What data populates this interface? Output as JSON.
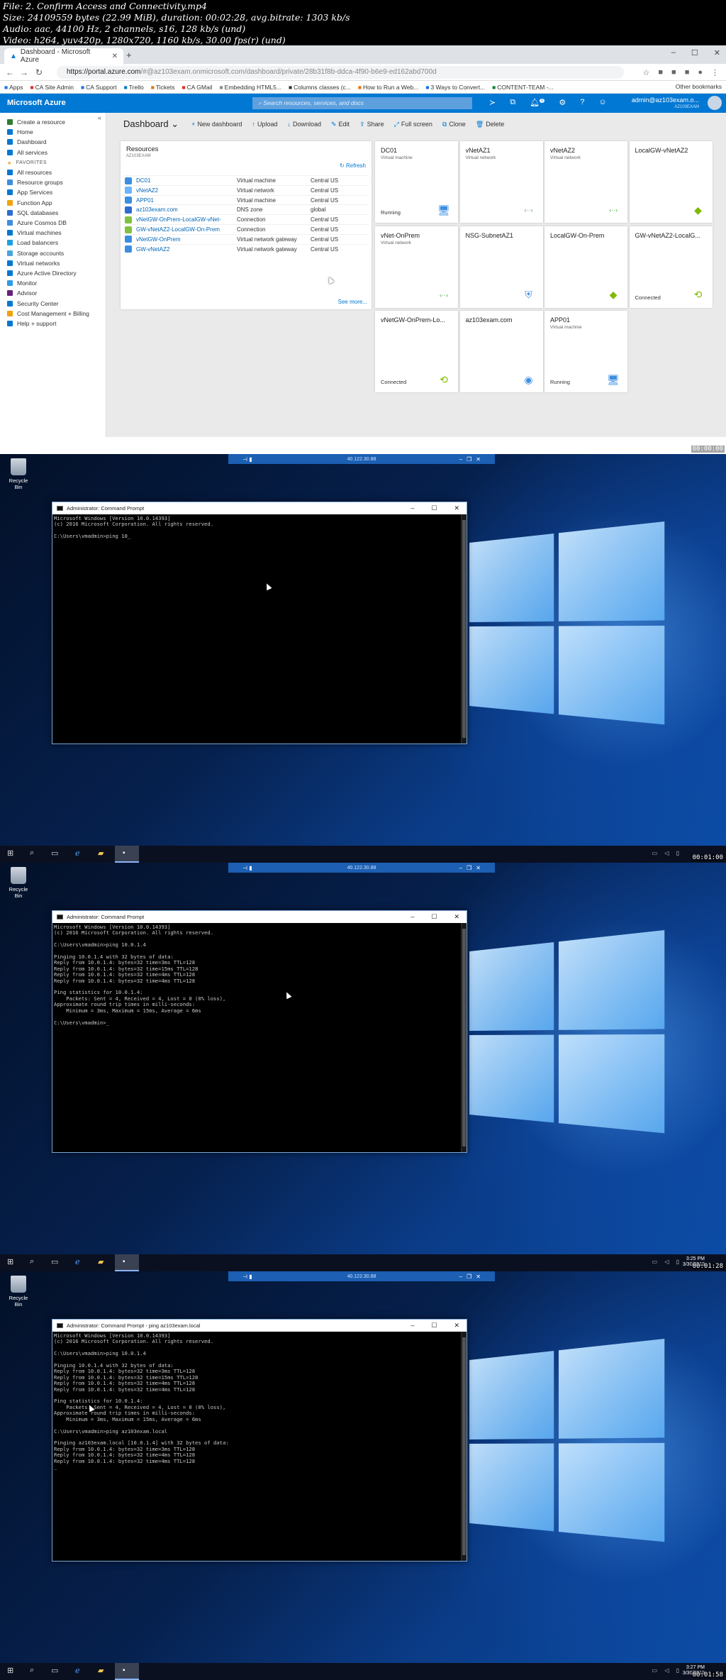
{
  "header": {
    "line1": "File: 2. Confirm Access and Connectivity.mp4",
    "line2": "Size: 24109559 bytes (22.99 MiB), duration: 00:02:28, avg.bitrate: 1303 kb/s",
    "line3": "Audio: aac, 44100 Hz, 2 channels, s16, 128 kb/s (und)",
    "line4": "Video: h264, yuv420p, 1280x720, 1160 kb/s, 30.00 fps(r) (und)"
  },
  "browser": {
    "tab_title": "Dashboard - Microsoft Azure",
    "url_host": "https://portal.azure.com",
    "url_path": "/#@az103exam.onmicrosoft.com/dashboard/private/28b31f8b-ddca-4f90-b6e9-ed162abd700d",
    "bookmarks": [
      "Apps",
      "CA Site Admin",
      "CA Support",
      "Trello",
      "Tickets",
      "CA GMail",
      "Embedding HTML5...",
      "Columns classes (c...",
      "How to Run a Web...",
      "3 Ways to Convert...",
      "CONTENT-TEAM -..."
    ],
    "other_bookmarks": "Other bookmarks",
    "timestamp": "00:00:00"
  },
  "azure": {
    "logo": "Microsoft Azure",
    "search_placeholder": "Search resources, services, and docs",
    "user_name": "admin@az103exam.o...",
    "user_dir": "AZ103EXAM",
    "notif_count": "1",
    "sidebar": {
      "items": [
        "Create a resource",
        "Home",
        "Dashboard",
        "All services"
      ],
      "favorites_label": "FAVORITES",
      "favorites": [
        "All resources",
        "Resource groups",
        "App Services",
        "Function App",
        "SQL databases",
        "Azure Cosmos DB",
        "Virtual machines",
        "Load balancers",
        "Storage accounts",
        "Virtual networks",
        "Azure Active Directory",
        "Monitor",
        "Advisor",
        "Security Center",
        "Cost Management + Billing",
        "Help + support"
      ]
    },
    "toolbar": {
      "title": "Dashboard",
      "actions": [
        "New dashboard",
        "Upload",
        "Download",
        "Edit",
        "Share",
        "Full screen",
        "Clone",
        "Delete"
      ]
    },
    "resources": {
      "title": "Resources",
      "subtitle": "AZ103EXAM",
      "refresh": "Refresh",
      "see_more": "See more...",
      "rows": [
        {
          "name": "DC01",
          "type": "Virtual machine",
          "location": "Central US"
        },
        {
          "name": "vNetAZ2",
          "type": "Virtual network",
          "location": "Central US"
        },
        {
          "name": "APP01",
          "type": "Virtual machine",
          "location": "Central US"
        },
        {
          "name": "az103exam.com",
          "type": "DNS zone",
          "location": "global"
        },
        {
          "name": "vNetGW-OnPrem-LocalGW-vNet-",
          "type": "Connection",
          "location": "Central US"
        },
        {
          "name": "GW-vNetAZ2-LocalGW-On-Prem",
          "type": "Connection",
          "location": "Central US"
        },
        {
          "name": "vNetGW-OnPrem",
          "type": "Virtual network gateway",
          "location": "Central US"
        },
        {
          "name": "GW-vNetAZ2",
          "type": "Virtual network gateway",
          "location": "Central US"
        }
      ]
    },
    "tiles": [
      {
        "title": "DC01",
        "sub": "Virtual machine",
        "status": "Running",
        "icon": "vm-icon"
      },
      {
        "title": "vNetAZ1",
        "sub": "Virtual network",
        "status": "",
        "icon": "vnet-icon"
      },
      {
        "title": "vNetAZ2",
        "sub": "Virtual network",
        "status": "",
        "icon": "vnet-icon"
      },
      {
        "title": "LocalGW-vNetAZ2",
        "sub": "",
        "status": "",
        "icon": "local-gateway-icon"
      },
      {
        "title": "vNet-OnPrem",
        "sub": "Virtual network",
        "status": "",
        "icon": "vnet-icon"
      },
      {
        "title": "NSG-SubnetAZ1",
        "sub": "",
        "status": "",
        "icon": "shield-icon"
      },
      {
        "title": "LocalGW-On-Prem",
        "sub": "",
        "status": "",
        "icon": "local-gateway-icon"
      },
      {
        "title": "GW-vNetAZ2-LocalG...",
        "sub": "",
        "status": "Connected",
        "icon": "connection-icon"
      },
      {
        "title": "vNetGW-OnPrem-Lo...",
        "sub": "",
        "status": "Connected",
        "icon": "connection-icon"
      },
      {
        "title": "az103exam.com",
        "sub": "",
        "status": "",
        "icon": "dns-icon"
      },
      {
        "title": "APP01",
        "sub": "Virtual machine",
        "status": "Running",
        "icon": "vm-icon"
      }
    ]
  },
  "desktop": {
    "recycle_bin": "Recycle Bin",
    "rdp_ip": "40.122.30.88",
    "panels": [
      {
        "window_title": "Administrator: Command Prompt",
        "console": "Microsoft Windows [Version 10.0.14393]\n(c) 2016 Microsoft Corporation. All rights reserved.\n\nC:\\Users\\vmadmin>ping 10_",
        "clock_time": "",
        "clock_date": "",
        "timestamp": "00:01:00"
      },
      {
        "window_title": "Administrator: Command Prompt",
        "console": "Microsoft Windows [Version 10.0.14393]\n(c) 2016 Microsoft Corporation. All rights reserved.\n\nC:\\Users\\vmadmin>ping 10.0.1.4\n\nPinging 10.0.1.4 with 32 bytes of data:\nReply from 10.0.1.4: bytes=32 time=3ms TTL=128\nReply from 10.0.1.4: bytes=32 time=15ms TTL=128\nReply from 10.0.1.4: bytes=32 time=4ms TTL=128\nReply from 10.0.1.4: bytes=32 time=4ms TTL=128\n\nPing statistics for 10.0.1.4:\n    Packets: Sent = 4, Received = 4, Lost = 0 (0% loss),\nApproximate round trip times in milli-seconds:\n    Minimum = 3ms, Maximum = 15ms, Average = 6ms\n\nC:\\Users\\vmadmin>_",
        "clock_time": "3:25 PM",
        "clock_date": "3/30/2019",
        "timestamp": "00:01:28"
      },
      {
        "window_title": "Administrator: Command Prompt - ping az103exam.local",
        "console": "Microsoft Windows [Version 10.0.14393]\n(c) 2016 Microsoft Corporation. All rights reserved.\n\nC:\\Users\\vmadmin>ping 10.0.1.4\n\nPinging 10.0.1.4 with 32 bytes of data:\nReply from 10.0.1.4: bytes=32 time=3ms TTL=128\nReply from 10.0.1.4: bytes=32 time=15ms TTL=128\nReply from 10.0.1.4: bytes=32 time=4ms TTL=128\nReply from 10.0.1.4: bytes=32 time=4ms TTL=128\n\nPing statistics for 10.0.1.4:\n    Packets: Sent = 4, Received = 4, Lost = 0 (0% loss),\nApproximate round trip times in milli-seconds:\n    Minimum = 3ms, Maximum = 15ms, Average = 6ms\n\nC:\\Users\\vmadmin>ping az103exam.local\n\nPinging az103exam.local [10.0.1.4] with 32 bytes of data:\nReply from 10.0.1.4: bytes=32 time=3ms TTL=128\nReply from 10.0.1.4: bytes=32 time=4ms TTL=128\nReply from 10.0.1.4: bytes=32 time=4ms TTL=128\n_",
        "clock_time": "3:27 PM",
        "clock_date": "3/30/2019",
        "timestamp": "00:01:58"
      }
    ]
  }
}
